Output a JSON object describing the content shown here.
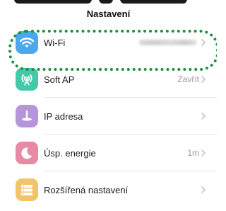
{
  "header": {
    "title": "Nastavení"
  },
  "settings": {
    "items": [
      {
        "label": "Wi-Fi",
        "value": "",
        "icon": "wifi-icon",
        "icon_color": "#4aa8ec"
      },
      {
        "label": "Soft AP",
        "value": "Zavřít",
        "icon": "antenna-icon",
        "icon_color": "#43c9a7"
      },
      {
        "label": "IP adresa",
        "value": "",
        "icon": "ip-pin-icon",
        "icon_color": "#b597d9"
      },
      {
        "label": "Úsp. energie",
        "value": "1m",
        "icon": "moon-icon",
        "icon_color": "#e88aa3"
      },
      {
        "label": "Rozšířená nastavení",
        "value": "",
        "icon": "advanced-settings-icon",
        "icon_color": "#f0c46a"
      }
    ]
  },
  "colors": {
    "highlight": "#1a8f3c",
    "chevron": "#c5c5c5"
  }
}
